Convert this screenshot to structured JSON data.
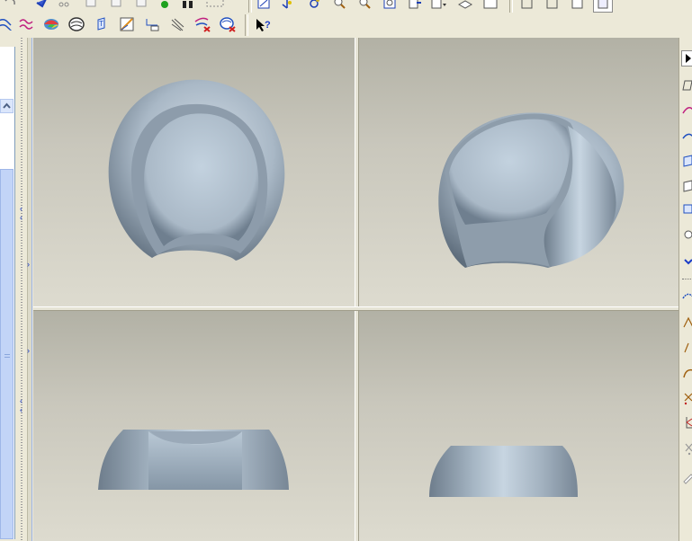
{
  "toolbar_top": {
    "row1_icons": [
      "undo-icon",
      "redo-icon",
      "cut-icon",
      "copy-icon",
      "paste-icon",
      "paste-special-icon",
      "regenerate-icon",
      "find-icon",
      "select-box-icon",
      "repaint-icon",
      "spin-center-icon",
      "refit-icon",
      "zoom-in-icon",
      "zoom-out-icon",
      "zoom-window-icon",
      "orient-icon",
      "saved-views-icon",
      "layers-icon",
      "view-manager-icon",
      "wireframe-icon",
      "hidden-line-icon",
      "no-hidden-icon",
      "shaded-icon"
    ],
    "row2_icons": [
      "datum-plane-icon",
      "datum-axis-icon",
      "datum-curve-icon",
      "datum-point-icon",
      "coordinate-system-icon",
      "analysis-icon",
      "measure-icon",
      "model-analysis-icon",
      "curvature-icon",
      "delete-analysis-icon",
      "spin-icon"
    ],
    "help_icon": "whats-this-help-icon",
    "help_glyph": "?"
  },
  "viewports": {
    "top_left": {
      "view": "front"
    },
    "top_right": {
      "view": "isometric"
    },
    "bottom_left": {
      "view": "top"
    },
    "bottom_right": {
      "view": "side"
    }
  },
  "right_toolbar": {
    "icons": [
      "select-icon",
      "sketch-icon",
      "spline-icon",
      "curve-icon",
      "surface-icon",
      "plane-icon",
      "offset-icon",
      "point-icon",
      "expand-icon",
      "datum-curve-icon",
      "line-icon",
      "arc-icon",
      "fillet-icon",
      "trim-icon",
      "coordinate-icon",
      "delete-icon",
      "edit-icon"
    ]
  },
  "colors": {
    "chrome": "#ece9d8",
    "model": "#a9b8c6",
    "accent": "#1a3cc8"
  }
}
